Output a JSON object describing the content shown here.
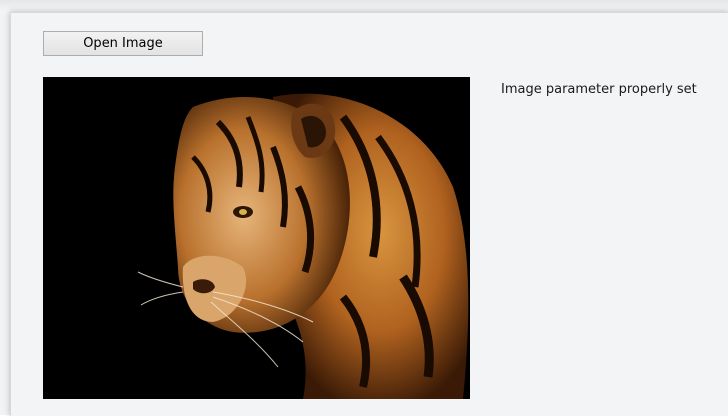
{
  "toolbar": {
    "open_image_label": "Open Image"
  },
  "main": {
    "status_message": "Image parameter properly set"
  },
  "colors": {
    "window_background": "#f3f4f6",
    "button_border": "#adadad",
    "image_background": "#000000",
    "tiger_orange": "#b86a2a"
  }
}
